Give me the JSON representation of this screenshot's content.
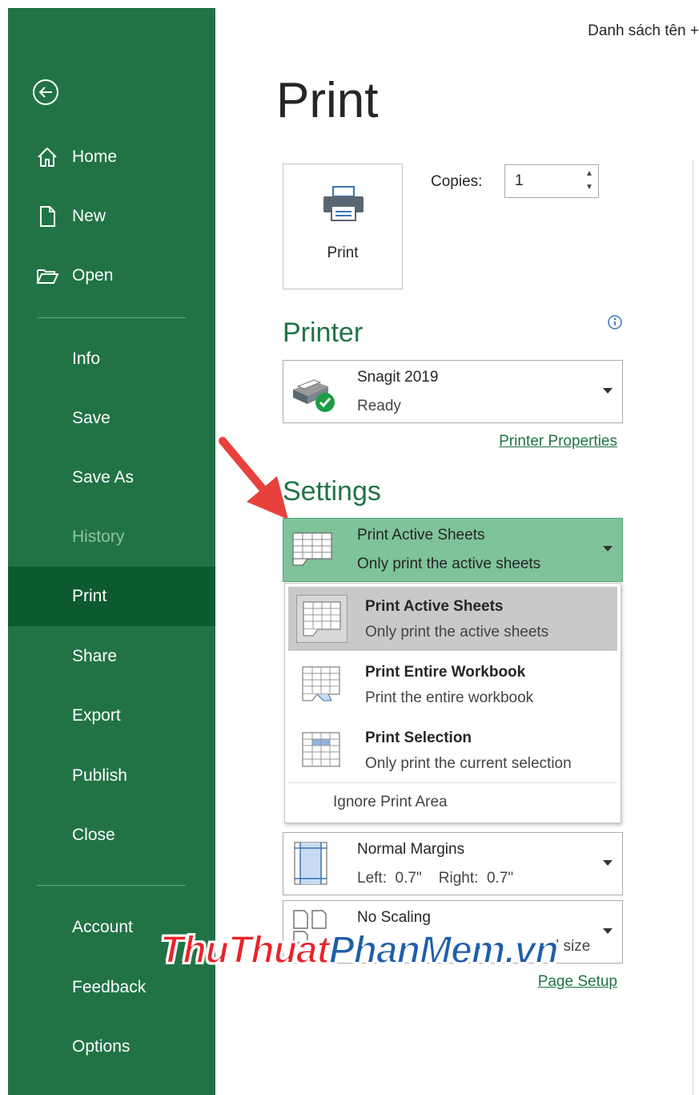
{
  "colors": {
    "accent": "#217346",
    "sidebar_active": "#0e5a30",
    "selected_setting_bg": "#7fc39a",
    "arrow": "#e8413c"
  },
  "document": {
    "name": "Danh sách tên +"
  },
  "sidebar": {
    "back_icon": "back-arrow-icon",
    "items": [
      {
        "label": "Home",
        "icon": "home-icon"
      },
      {
        "label": "New",
        "icon": "new-document-icon"
      },
      {
        "label": "Open",
        "icon": "open-folder-icon"
      },
      {
        "label": "Info"
      },
      {
        "label": "Save"
      },
      {
        "label": "Save As"
      },
      {
        "label": "History",
        "disabled": true
      },
      {
        "label": "Print",
        "active": true
      },
      {
        "label": "Share"
      },
      {
        "label": "Export"
      },
      {
        "label": "Publish"
      },
      {
        "label": "Close"
      },
      {
        "label": "Account"
      },
      {
        "label": "Feedback"
      },
      {
        "label": "Options"
      }
    ]
  },
  "main": {
    "title": "Print",
    "print_button": {
      "label": "Print",
      "icon": "printer-icon"
    },
    "copies": {
      "label": "Copies:",
      "value": "1"
    },
    "printer": {
      "section_title": "Printer",
      "info_icon": "info-icon",
      "name": "Snagit 2019",
      "status": "Ready",
      "properties_link": "Printer Properties"
    },
    "settings": {
      "section_title": "Settings",
      "scope": {
        "title": "Print Active Sheets",
        "subtitle": "Only print the active sheets"
      },
      "menu": {
        "options": [
          {
            "title": "Print Active Sheets",
            "subtitle": "Only print the active sheets",
            "selected": true
          },
          {
            "title": "Print Entire Workbook",
            "subtitle": "Print the entire workbook"
          },
          {
            "title": "Print Selection",
            "subtitle": "Only print the current selection"
          }
        ],
        "ignore_print_area": "Ignore Print Area"
      },
      "margins": {
        "title": "Normal Margins",
        "subtitle": "Left:  0.7\"    Right:  0.7\""
      },
      "scaling": {
        "title": "No Scaling",
        "subtitle": "l size"
      },
      "page_setup_link": "Page Setup"
    }
  },
  "watermark": {
    "part1": "ThuThuat",
    "part2": "PhanMem",
    "part3": ".vn"
  }
}
